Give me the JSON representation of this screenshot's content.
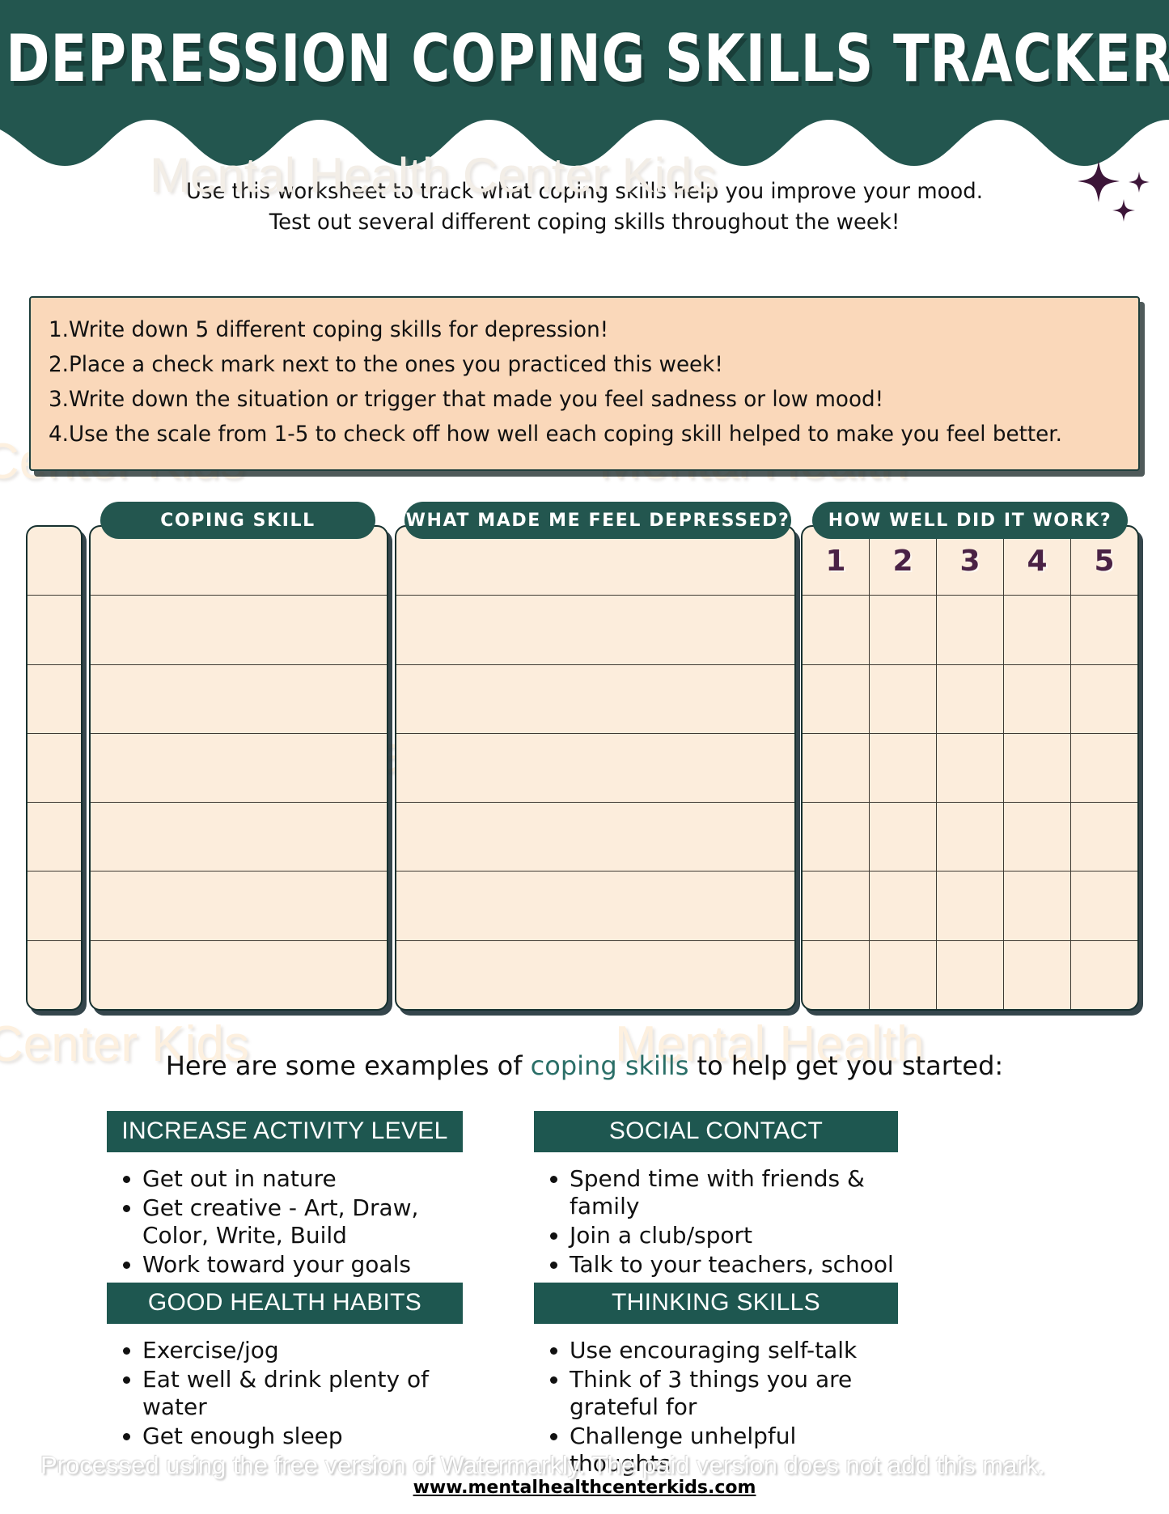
{
  "header": {
    "title": "Depression Coping Skills Tracker",
    "sparkle_icon": "sparkles-icon"
  },
  "intro": {
    "line1": "Use this worksheet to track what coping skills help you improve your mood.",
    "line2": "Test out several different coping skills throughout the week!"
  },
  "instructions": {
    "items": [
      "1.Write down 5 different coping skills for depression!",
      "2.Place a check mark next to the ones you practiced this week!",
      "3.Write down the situation or trigger that made you feel sadness or low mood!",
      "4.Use the scale from 1-5 to check off how well each coping skill helped to make you feel better."
    ]
  },
  "tracker": {
    "headers": {
      "check": "",
      "skill": "Coping Skill",
      "reason": "What made me feel depressed?",
      "rating": "How well did it work?"
    },
    "rating_scale": [
      "1",
      "2",
      "3",
      "4",
      "5"
    ],
    "row_count": 7,
    "rows": [
      {
        "check": "",
        "skill": "",
        "reason": "",
        "rating": ""
      },
      {
        "check": "",
        "skill": "",
        "reason": "",
        "rating": ""
      },
      {
        "check": "",
        "skill": "",
        "reason": "",
        "rating": ""
      },
      {
        "check": "",
        "skill": "",
        "reason": "",
        "rating": ""
      },
      {
        "check": "",
        "skill": "",
        "reason": "",
        "rating": ""
      },
      {
        "check": "",
        "skill": "",
        "reason": "",
        "rating": ""
      },
      {
        "check": "",
        "skill": "",
        "reason": "",
        "rating": ""
      }
    ]
  },
  "examples": {
    "lead_before": "Here are some examples of ",
    "lead_accent": "coping skills",
    "lead_after": " to help get you started:",
    "categories": [
      {
        "title": "INCREASE ACTIVITY LEVEL",
        "items": [
          "Get out in nature",
          "Get creative - Art, Draw, Color, Write, Build",
          "Work toward your goals"
        ]
      },
      {
        "title": "SOCIAL CONTACT",
        "items": [
          "Spend time with friends & family",
          "Join a club/sport",
          "Talk to your teachers, school counselor, or therapist"
        ]
      },
      {
        "title": "GOOD HEALTH HABITS",
        "items": [
          "Exercise/jog",
          "Eat well & drink plenty of water",
          "Get enough sleep"
        ]
      },
      {
        "title": "THINKING SKILLS",
        "items": [
          "Use encouraging self-talk",
          "Think of 3 things you are grateful for",
          "Challenge unhelpful thoughts"
        ]
      }
    ]
  },
  "footer": {
    "watermark_strip": "Processed using the free version of Watermarkly. The paid version does not add this mark.",
    "url": "www.mentalhealthcenterkids.com"
  },
  "watermarks": {
    "brand": "Mental Health Center Kids",
    "frag_left": "th Center Kids",
    "frag_right": "Mental Health"
  },
  "colors": {
    "teal": "#23564f",
    "teal_dark": "#1e5750",
    "cream": "#fceddc",
    "peach": "#fad8ba",
    "purple": "#4a2245",
    "ink": "#16302f"
  }
}
